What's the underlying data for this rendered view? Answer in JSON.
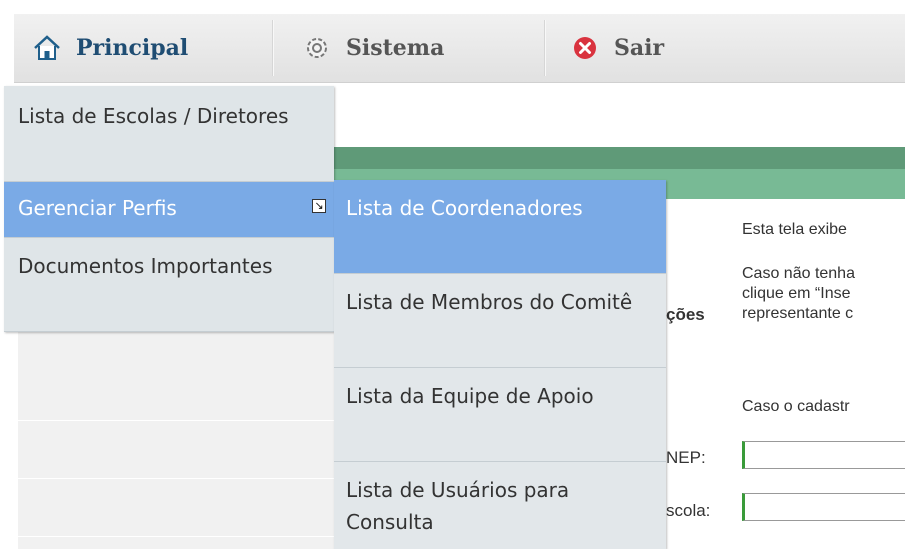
{
  "nav": {
    "principal": "Principal",
    "sistema": "Sistema",
    "sair": "Sair"
  },
  "menu": {
    "items": [
      {
        "label": "Lista de Escolas / Diretores"
      },
      {
        "label": "Gerenciar Perfis"
      },
      {
        "label": "Documentos Importantes"
      }
    ],
    "submenu": [
      {
        "label": "Lista de Coordenadores"
      },
      {
        "label": "Lista de Membros do Comitê"
      },
      {
        "label": "Lista da Equipe de Apoio"
      },
      {
        "label": "Lista de Usuários para Consulta"
      }
    ]
  },
  "page": {
    "label_fragment_1": "ções",
    "label_fragment_2": "NEP:",
    "label_fragment_3": "scola:",
    "desc_1": "Esta tela exibe",
    "desc_2_line1": "Caso não tenha",
    "desc_2_line2": "clique em “Inse",
    "desc_2_line3": "representante c",
    "desc_3": "Caso o cadastr"
  },
  "colors": {
    "menu_highlight": "#7aaae6",
    "menu_bg": "#dfe5e8",
    "nav_text": "#1f4d73",
    "header_green": "#5f9a78",
    "subheader_green": "#78ba95",
    "exit_red": "#d9333f"
  },
  "icons": {
    "principal": "home-icon",
    "sistema": "gear-icon",
    "sair": "close-circle-icon",
    "submenu": "submenu-arrow-icon"
  }
}
